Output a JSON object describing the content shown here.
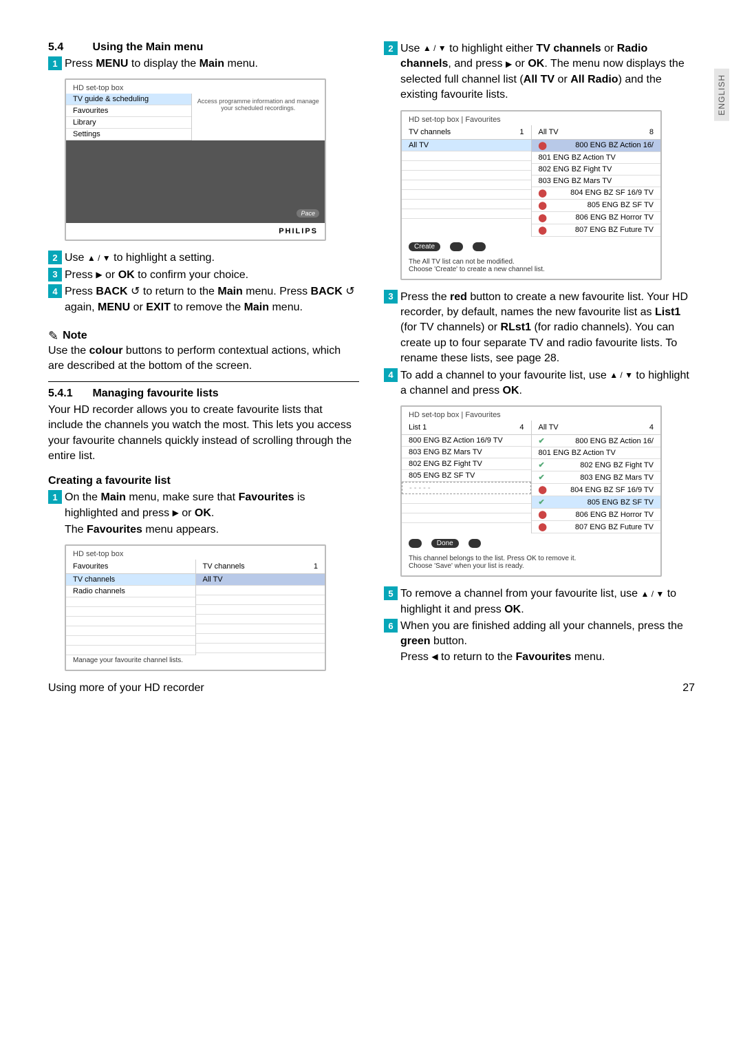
{
  "sideTab": "ENGLISH",
  "footer": {
    "left": "Using more of your HD recorder",
    "page": "27"
  },
  "h1": {
    "num": "5.4",
    "title": "Using the Main menu"
  },
  "step1": {
    "n": "1",
    "t1": "Press ",
    "b1": "MENU",
    "t2": " to display the ",
    "b2": "Main",
    "t3": " menu."
  },
  "mainMenu": {
    "title": "HD set-top box",
    "items": [
      "TV guide & scheduling",
      "Favourites",
      "Library",
      "Settings"
    ],
    "desc": "Access programme information and manage your scheduled recordings.",
    "brand": "PHILIPS",
    "pace": "Pace"
  },
  "step2": {
    "n": "2",
    "t1": "Use ",
    "arrows": "▲ / ▼",
    "t2": " to highlight a setting."
  },
  "step3": {
    "n": "3",
    "t1": "Press ",
    "arrow": "▶",
    "t2": " or ",
    "b1": "OK",
    "t3": " to confirm your choice."
  },
  "step4": {
    "n": "4",
    "t1": "Press ",
    "b1": "BACK",
    "back": " ↺",
    "t2": " to return to the ",
    "b2": "Main",
    "t3": " menu. Press ",
    "b3": "BACK",
    "back2": " ↺",
    "t4": " again, ",
    "b4": "MENU",
    "t5": " or ",
    "b5": "EXIT",
    "t6": " to remove the ",
    "b6": "Main",
    "t7": " menu."
  },
  "noteLabel": "Note",
  "noteBody": {
    "t1": "Use the ",
    "b1": "colour",
    "t2": " buttons to perform contextual actions, which are described at the bottom of the screen."
  },
  "h2": {
    "num": "5.4.1",
    "title": "Managing favourite lists"
  },
  "favIntro": "Your HD recorder allows you to create favourite lists that include the channels you watch the most. This lets you access your favourite channels quickly instead of scrolling through the entire list.",
  "createTitle": "Creating a favourite list",
  "create1": {
    "n": "1",
    "t1": "On the ",
    "b1": "Main",
    "t2": " menu, make sure that ",
    "b2": "Favourites",
    "t3": " is highlighted and press ",
    "arrow": "▶",
    "t4": " or ",
    "b3": "OK",
    "t5": "."
  },
  "favMenuAppears": {
    "t1": "The ",
    "b1": "Favourites",
    "t2": " menu appears."
  },
  "favScreen1": {
    "title": "HD set-top box",
    "leftHeader": "Favourites",
    "rightHeader": "TV channels",
    "rightCount": "1",
    "leftItems": [
      "TV channels",
      "Radio channels"
    ],
    "rightItems": [
      "All TV"
    ],
    "footer": "Manage your favourite channel lists."
  },
  "stepR2": {
    "n": "2",
    "t1": "Use ",
    "arrows": "▲ / ▼",
    "t2": " to highlight either ",
    "b1": "TV channels",
    "t3": " or ",
    "b2": "Radio channels",
    "t4": ", and press ",
    "arrow": "▶",
    "t5": " or ",
    "b3": "OK",
    "t6": ".",
    "t7": "The menu now displays the selected full channel list (",
    "b4": "All TV",
    "t8": " or ",
    "b5": "All Radio",
    "t9": ") and the existing favourite lists."
  },
  "favScreen2": {
    "title": "HD set-top box | Favourites",
    "leftHeader": "TV channels",
    "leftCount": "1",
    "rightHeader": "All TV",
    "rightCount": "8",
    "leftItems": [
      "All TV"
    ],
    "rightItems": [
      "800 ENG BZ Action 16/",
      "801 ENG BZ Action TV",
      "802 ENG BZ Fight TV",
      "803 ENG BZ Mars TV",
      "804 ENG BZ SF 16/9 TV",
      "805 ENG BZ SF TV",
      "806 ENG BZ Horror TV",
      "807 ENG BZ Future TV"
    ],
    "create": "Create",
    "footer1": "The All TV list can not be modified.",
    "footer2": "Choose 'Create' to create a new channel list."
  },
  "stepR3": {
    "n": "3",
    "t1": "Press the ",
    "b1": "red",
    "t2": " button to create a new favourite list. Your HD recorder, by default, names the new favourite list as ",
    "b2": "List1",
    "t3": " (for TV channels) or ",
    "b3": "RLst1",
    "t4": " (for radio channels). You can create up to four separate TV and radio favourite lists. To rename these lists, see page 28."
  },
  "stepR4": {
    "n": "4",
    "t1": "To add a channel to your favourite list, use ",
    "arrows": "▲ / ▼",
    "t2": " to highlight a channel and press ",
    "b1": "OK",
    "t3": "."
  },
  "favScreen3": {
    "title": "HD set-top box | Favourites",
    "leftHeader": "List 1",
    "leftCount": "4",
    "rightHeader": "All TV",
    "rightCount": "4",
    "leftItems": [
      "800 ENG BZ Action 16/9 TV",
      "803 ENG BZ Mars TV",
      "802 ENG BZ Fight TV",
      "805 ENG BZ SF TV"
    ],
    "rightItems": [
      "800 ENG BZ Action 16/",
      "801 ENG BZ Action TV",
      "802 ENG BZ Fight TV",
      "803 ENG BZ Mars TV",
      "804 ENG BZ SF 16/9 TV",
      "805 ENG BZ SF TV",
      "806 ENG BZ Horror TV",
      "807 ENG BZ Future TV"
    ],
    "checked": [
      0,
      2,
      3,
      5
    ],
    "done": "Done",
    "footer1": "This channel belongs to the list. Press OK to remove it.",
    "footer2": "Choose 'Save' when your list is ready."
  },
  "stepR5": {
    "n": "5",
    "t1": "To remove a channel from your favourite list, use ",
    "arrows": "▲ / ▼",
    "t2": " to highlight it and press ",
    "b1": "OK",
    "t3": "."
  },
  "stepR6": {
    "n": "6",
    "t1": "When you are finished adding all your channels, press the ",
    "b1": "green",
    "t2": " button.",
    "t3": "Press ",
    "arrow": "◀",
    "t4": " to return to the ",
    "b2": "Favourites",
    "t5": " menu."
  }
}
